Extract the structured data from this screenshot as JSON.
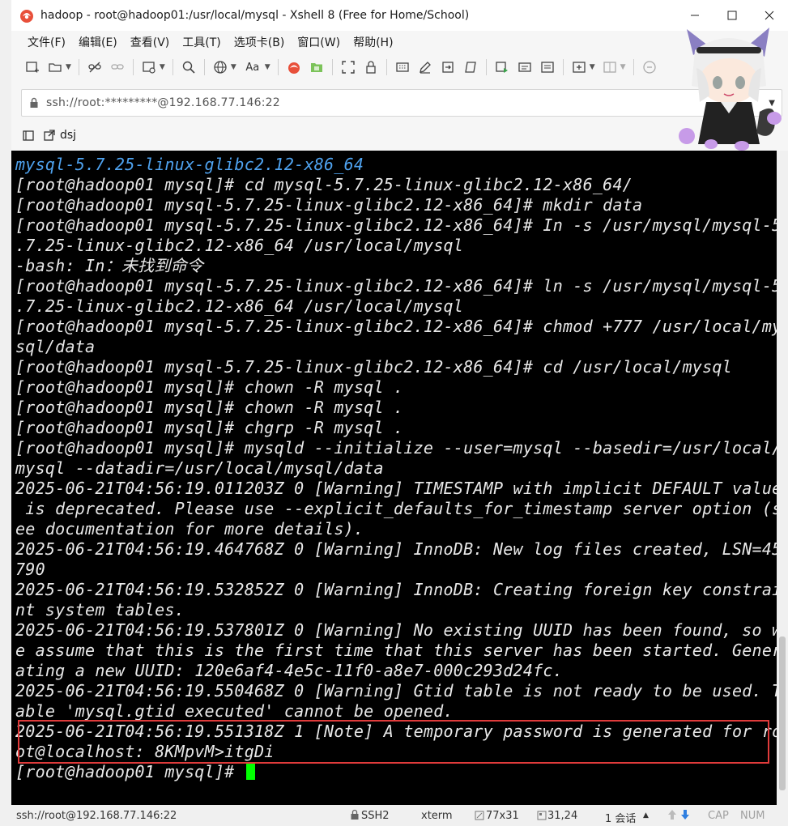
{
  "window": {
    "title": "hadoop - root@hadoop01:/usr/local/mysql - Xshell 8 (Free for Home/School)"
  },
  "menu": [
    "文件(F)",
    "编辑(E)",
    "查看(V)",
    "工具(T)",
    "选项卡(B)",
    "窗口(W)",
    "帮助(H)"
  ],
  "toolbar": {
    "font_label": "Aa"
  },
  "address": {
    "url": "ssh://root:*********@192.168.77.146:22"
  },
  "tabs": [
    {
      "label": "dsj"
    }
  ],
  "terminal": {
    "lines": [
      "mysql-5.7.25-linux-glibc2.12-x86_64",
      "[root@hadoop01 mysql]# cd mysql-5.7.25-linux-glibc2.12-x86_64/",
      "[root@hadoop01 mysql-5.7.25-linux-glibc2.12-x86_64]# mkdir data",
      "[root@hadoop01 mysql-5.7.25-linux-glibc2.12-x86_64]# In -s /usr/mysql/mysql-5",
      ".7.25-linux-glibc2.12-x86_64 /usr/local/mysql",
      "-bash: In：未找到命令",
      "[root@hadoop01 mysql-5.7.25-linux-glibc2.12-x86_64]# ln -s /usr/mysql/mysql-5",
      ".7.25-linux-glibc2.12-x86_64 /usr/local/mysql",
      "[root@hadoop01 mysql-5.7.25-linux-glibc2.12-x86_64]# chmod +777 /usr/local/my",
      "sql/data",
      "[root@hadoop01 mysql-5.7.25-linux-glibc2.12-x86_64]# cd /usr/local/mysql",
      "[root@hadoop01 mysql]# chown -R mysql .",
      "[root@hadoop01 mysql]# chown -R mysql .",
      "[root@hadoop01 mysql]# chgrp -R mysql .",
      "[root@hadoop01 mysql]# mysqld --initialize --user=mysql --basedir=/usr/local/",
      "mysql --datadir=/usr/local/mysql/data",
      "2025-06-21T04:56:19.011203Z 0 [Warning] TIMESTAMP with implicit DEFAULT value",
      " is deprecated. Please use --explicit_defaults_for_timestamp server option (s",
      "ee documentation for more details).",
      "2025-06-21T04:56:19.464768Z 0 [Warning] InnoDB: New log files created, LSN=45",
      "790",
      "2025-06-21T04:56:19.532852Z 0 [Warning] InnoDB: Creating foreign key constrai",
      "nt system tables.",
      "2025-06-21T04:56:19.537801Z 0 [Warning] No existing UUID has been found, so w",
      "e assume that this is the first time that this server has been started. Gener",
      "ating a new UUID: 120e6af4-4e5c-11f0-a8e7-000c293d24fc.",
      "2025-06-21T04:56:19.550468Z 0 [Warning] Gtid table is not ready to be used. T",
      "able 'mysql.gtid_executed' cannot be opened.",
      "2025-06-21T04:56:19.551318Z 1 [Note] A temporary password is generated for ro",
      "ot@localhost: 8KMpvM>itgDi"
    ],
    "prompt": "[root@hadoop01 mysql]# "
  },
  "status": {
    "connection": "ssh://root@192.168.77.146:22",
    "protocol": "SSH2",
    "term": "xterm",
    "size": "77x31",
    "cursor_pos": "31,24",
    "sessions": "1 会话",
    "cap": "CAP",
    "num": "NUM"
  },
  "colors": {
    "terminal_bg": "#000000",
    "terminal_fg": "#e8e8e8",
    "dir_blue": "#4fa3f0",
    "cursor": "#00ff00",
    "highlight": "#e03b3b"
  }
}
